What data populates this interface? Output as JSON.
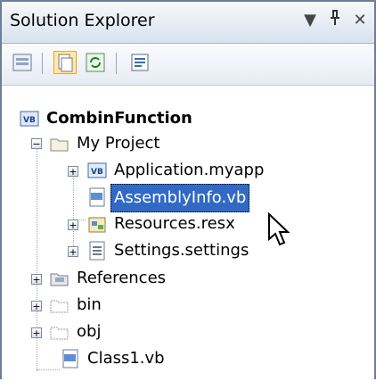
{
  "panel": {
    "title": "Solution Explorer"
  },
  "toolbar": {
    "buttons": [
      "properties-icon",
      "show-all-files-icon",
      "refresh-icon",
      "view-code-icon"
    ]
  },
  "tree": {
    "root": "CombinFunction",
    "my_project": "My Project",
    "application": "Application.myapp",
    "assemblyinfo": "AssemblyInfo.vb",
    "resources": "Resources.resx",
    "settings": "Settings.settings",
    "references": "References",
    "bin": "bin",
    "obj": "obj",
    "class1": "Class1.vb"
  },
  "colors": {
    "selection": "#316ac5",
    "accent": "#2e6db4"
  }
}
